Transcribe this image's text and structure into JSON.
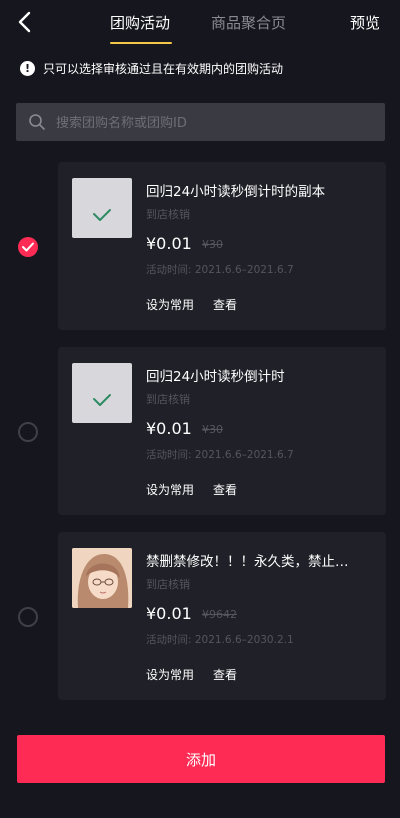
{
  "header": {
    "tabs": [
      {
        "label": "团购活动",
        "active": true
      },
      {
        "label": "商品聚合页",
        "active": false
      }
    ],
    "preview_label": "预览"
  },
  "notice": {
    "icon": "exclamation-icon",
    "text": "只可以选择审核通过且在有效期内的团购活动"
  },
  "search": {
    "placeholder": "搜索团购名称或团购ID",
    "value": ""
  },
  "items": [
    {
      "selected": true,
      "title": "回归24小时读秒倒计时的副本",
      "subtitle": "到店核销",
      "price": "¥0.01",
      "original_price": "¥30",
      "time": "活动时间: 2021.6.6–2021.6.7",
      "actions": {
        "set_common": "设为常用",
        "view": "查看"
      }
    },
    {
      "selected": false,
      "title": "回归24小时读秒倒计时",
      "subtitle": "到店核销",
      "price": "¥0.01",
      "original_price": "¥30",
      "time": "活动时间: 2021.6.6–2021.6.7",
      "actions": {
        "set_common": "设为常用",
        "view": "查看"
      }
    },
    {
      "selected": false,
      "title": "禁删禁修改！！！永久类，禁止…",
      "subtitle": "到店核销",
      "price": "¥0.01",
      "original_price": "¥9642",
      "time": "活动时间: 2021.6.6–2030.2.1",
      "actions": {
        "set_common": "设为常用",
        "view": "查看"
      }
    }
  ],
  "add_button_label": "添加",
  "colors": {
    "background": "#16161e",
    "card": "#202028",
    "accent": "#fe2c55",
    "tab_underline": "#f3c748"
  }
}
